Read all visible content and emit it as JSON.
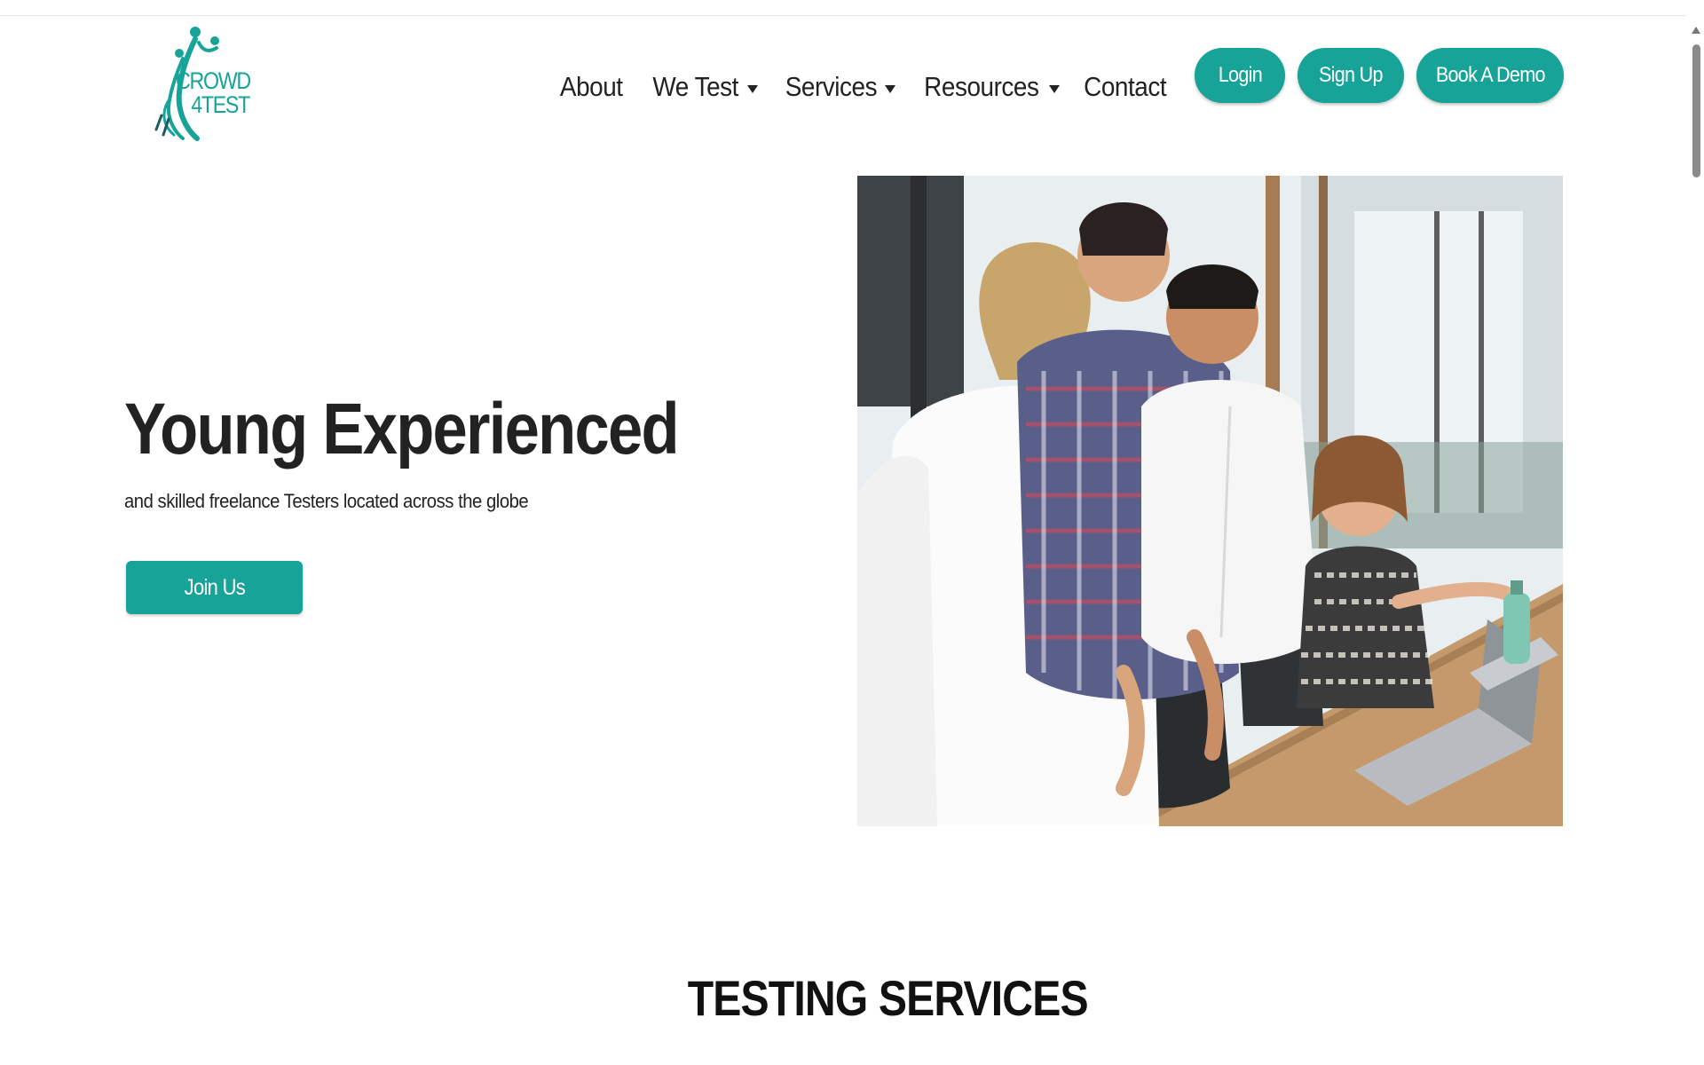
{
  "brand": {
    "logo_line1": "CROWD",
    "logo_line2": "4TEST",
    "accent_color": "#17a398"
  },
  "nav": {
    "items": [
      {
        "label": "About",
        "has_dropdown": false
      },
      {
        "label": "We Test",
        "has_dropdown": true
      },
      {
        "label": "Services",
        "has_dropdown": true
      },
      {
        "label": "Resources",
        "has_dropdown": true
      },
      {
        "label": "Contact",
        "has_dropdown": false
      }
    ],
    "login_label": "Login",
    "signup_label": "Sign Up",
    "demo_label": "Book A Demo"
  },
  "hero": {
    "title": "Young Experienced",
    "subtitle": "and skilled freelance Testers located across the globe",
    "cta_label": "Join Us",
    "image_icon": "team-photo-image"
  },
  "section": {
    "title": "TESTING SERVICES"
  },
  "icons": {
    "dropdown": "caret-down-icon",
    "scroll_up": "arrow-up-icon"
  }
}
